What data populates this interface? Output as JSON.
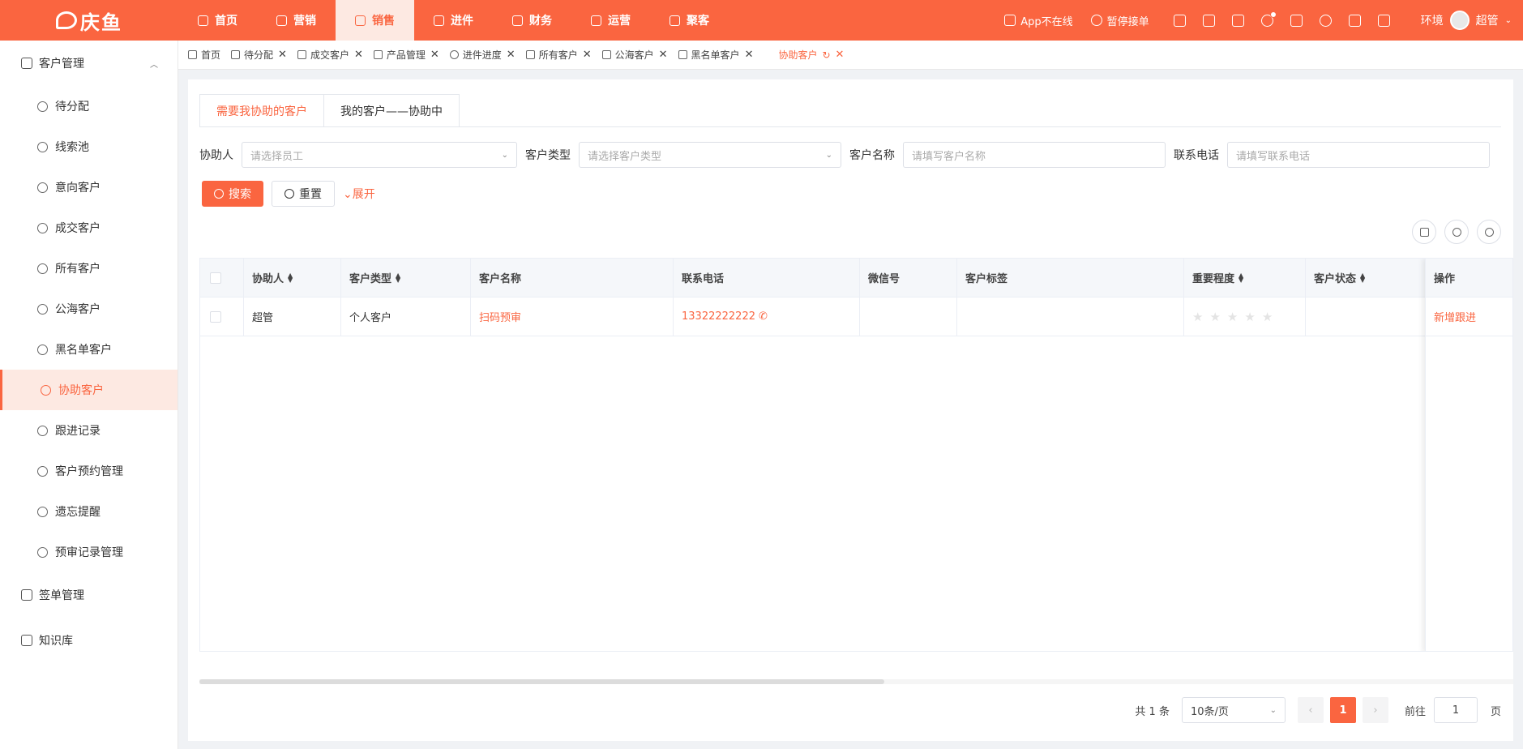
{
  "brand": "庆鱼",
  "topnav": [
    {
      "label": "首页",
      "icon": "home-icon"
    },
    {
      "label": "营销",
      "icon": "chart-icon"
    },
    {
      "label": "销售",
      "icon": "user-icon"
    },
    {
      "label": "进件",
      "icon": "document-icon"
    },
    {
      "label": "财务",
      "icon": "finance-icon"
    },
    {
      "label": "运营",
      "icon": "operation-icon"
    },
    {
      "label": "聚客",
      "icon": "group-icon"
    }
  ],
  "topnav_active": 2,
  "topright": {
    "app_status": "App不在线",
    "pause": "暂停接单",
    "env": "环境",
    "user": "超管"
  },
  "sidebar": {
    "group1": "客户管理",
    "items": [
      {
        "label": "待分配",
        "icon": "assign-icon"
      },
      {
        "label": "线索池",
        "icon": "pool-icon"
      },
      {
        "label": "意向客户",
        "icon": "intent-icon"
      },
      {
        "label": "成交客户",
        "icon": "deal-icon"
      },
      {
        "label": "所有客户",
        "icon": "all-customers-icon"
      },
      {
        "label": "公海客户",
        "icon": "public-icon"
      },
      {
        "label": "黑名单客户",
        "icon": "blacklist-icon"
      },
      {
        "label": "协助客户",
        "icon": "assist-icon"
      },
      {
        "label": "跟进记录",
        "icon": "record-icon"
      },
      {
        "label": "客户预约管理",
        "icon": "appointment-icon"
      },
      {
        "label": "遗忘提醒",
        "icon": "alarm-icon"
      },
      {
        "label": "预审记录管理",
        "icon": "review-icon"
      }
    ],
    "active_index": 7,
    "group2": "签单管理",
    "group3": "知识库"
  },
  "tabs": [
    {
      "label": "首页"
    },
    {
      "label": "待分配"
    },
    {
      "label": "成交客户"
    },
    {
      "label": "产品管理"
    },
    {
      "label": "进件进度"
    },
    {
      "label": "所有客户"
    },
    {
      "label": "公海客户"
    },
    {
      "label": "黑名单客户"
    },
    {
      "label": "协助客户"
    }
  ],
  "subtabs": [
    "需要我协助的客户",
    "我的客户——协助中"
  ],
  "filters": {
    "assistant_label": "协助人",
    "assistant_placeholder": "请选择员工",
    "type_label": "客户类型",
    "type_placeholder": "请选择客户类型",
    "name_label": "客户名称",
    "name_placeholder": "请填写客户名称",
    "phone_label": "联系电话",
    "phone_placeholder": "请填写联系电话"
  },
  "buttons": {
    "search": "搜索",
    "reset": "重置",
    "expand": "展开"
  },
  "table": {
    "columns": [
      "协助人",
      "客户类型",
      "客户名称",
      "联系电话",
      "微信号",
      "客户标签",
      "重要程度",
      "客户状态",
      "操作"
    ],
    "rows": [
      {
        "assistant": "超管",
        "type": "个人客户",
        "name": "扫码预审",
        "phone": "13322222222",
        "wechat": "",
        "tags": "",
        "importance": 0,
        "status": "",
        "action": "新增跟进"
      }
    ]
  },
  "pagination": {
    "total": "共 1 条",
    "page_size": "10条/页",
    "current": "1",
    "goto_label": "前往",
    "goto_value": "1",
    "page_unit": "页"
  },
  "colors": {
    "accent": "#fa6540",
    "accent_light": "#fde9e2"
  }
}
